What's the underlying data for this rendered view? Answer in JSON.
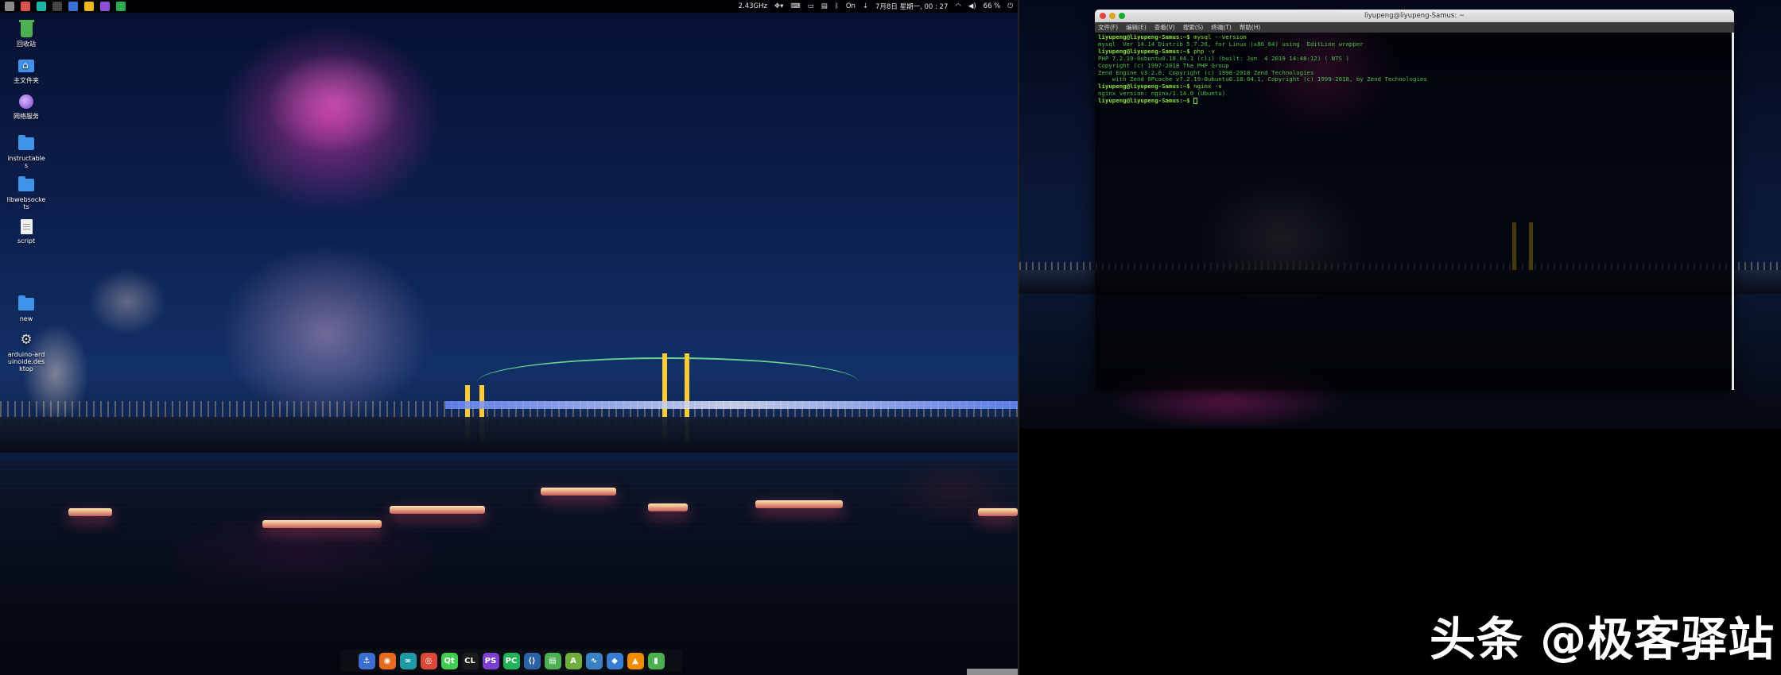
{
  "topbar": {
    "apps": [
      {
        "icon": "files-icon",
        "color": "#8a8a8a"
      },
      {
        "icon": "app-red-icon",
        "color": "#d9534f"
      },
      {
        "icon": "shield-icon",
        "color": "#1bb5a5"
      },
      {
        "icon": "terminal-icon",
        "color": "#444444"
      },
      {
        "icon": "editor-icon",
        "color": "#3a6fd6"
      },
      {
        "icon": "chrome-icon",
        "color": "#e8b923"
      },
      {
        "icon": "jetbrains-icon",
        "color": "#8d4fd6"
      },
      {
        "icon": "monitor-icon",
        "color": "#2fa84f"
      }
    ],
    "cpu": "2.43GHz",
    "input_method": "On",
    "datetime": "7月8日 星期一, 00 : 27",
    "battery": "66 %"
  },
  "desktop": {
    "icons": [
      {
        "label": "回收站",
        "icon": "trash-icon"
      },
      {
        "label": "主文件夹",
        "icon": "home-folder-icon"
      },
      {
        "label": "网络服务",
        "icon": "network-icon"
      },
      {
        "label": "instructables",
        "icon": "folder-icon"
      },
      {
        "label": "libwebsockets",
        "icon": "folder-icon"
      },
      {
        "label": "script",
        "icon": "document-icon"
      },
      {
        "label": "new",
        "icon": "folder-icon"
      },
      {
        "label": "arduino-arduinoide.desktop",
        "icon": "gear-icon"
      }
    ]
  },
  "dock": {
    "items": [
      {
        "icon": "anchor-icon",
        "glyph": "⚓",
        "color": "#3b6fcf"
      },
      {
        "icon": "firefox-icon",
        "glyph": "◉",
        "color": "#e66a1f"
      },
      {
        "icon": "arduino-icon",
        "glyph": "∞",
        "color": "#1f9aa5"
      },
      {
        "icon": "chrome-icon",
        "glyph": "◎",
        "color": "#d94a38"
      },
      {
        "icon": "qt-icon",
        "glyph": "Qt",
        "color": "#41cd52"
      },
      {
        "icon": "clion-icon",
        "glyph": "CL",
        "color": "#1b1b1b"
      },
      {
        "icon": "phpstorm-icon",
        "glyph": "PS",
        "color": "#7c3fd0"
      },
      {
        "icon": "pycharm-icon",
        "glyph": "PC",
        "color": "#20b35a"
      },
      {
        "icon": "vscode-icon",
        "glyph": "⟨⟩",
        "color": "#2b63a8"
      },
      {
        "icon": "files-icon",
        "glyph": "▤",
        "color": "#4caf50"
      },
      {
        "icon": "android-studio-icon",
        "glyph": "A",
        "color": "#6fae3a"
      },
      {
        "icon": "monitor-icon",
        "glyph": "∿",
        "color": "#3b82c4"
      },
      {
        "icon": "bag-icon",
        "glyph": "◆",
        "color": "#3a7bd5"
      },
      {
        "icon": "vlc-icon",
        "glyph": "▲",
        "color": "#f08c00"
      },
      {
        "icon": "trash-icon",
        "glyph": "▮",
        "color": "#4caf50"
      }
    ]
  },
  "terminal": {
    "title": "liyupeng@liyupeng-Samus: ~",
    "menu": [
      "文件(F)",
      "编辑(E)",
      "查看(V)",
      "搜索(S)",
      "终端(T)",
      "帮助(H)"
    ],
    "lines": [
      {
        "type": "prompt",
        "prompt": "liyupeng@liyupeng-Samus:~$",
        "text": " mysql --version"
      },
      {
        "type": "output",
        "text": "mysql  Ver 14.14 Distrib 5.7.26, for Linux (x86_64) using  EditLine wrapper"
      },
      {
        "type": "prompt",
        "prompt": "liyupeng@liyupeng-Samus:~$",
        "text": " php -v"
      },
      {
        "type": "output",
        "text": "PHP 7.2.19-0ubuntu0.18.04.1 (cli) (built: Jun  4 2019 14:48:12) ( NTS )"
      },
      {
        "type": "output",
        "text": "Copyright (c) 1997-2018 The PHP Group"
      },
      {
        "type": "output",
        "text": "Zend Engine v3.2.0, Copyright (c) 1998-2018 Zend Technologies"
      },
      {
        "type": "output",
        "text": "    with Zend OPcache v7.2.19-0ubuntu0.18.04.1, Copyright (c) 1999-2018, by Zend Technologies"
      },
      {
        "type": "prompt",
        "prompt": "liyupeng@liyupeng-Samus:~$",
        "text": " nginx -v"
      },
      {
        "type": "output",
        "text": "nginx version: nginx/1.14.0 (Ubuntu)"
      },
      {
        "type": "prompt",
        "prompt": "liyupeng@liyupeng-Samus:~$",
        "text": " "
      }
    ]
  },
  "watermark": "头条 @极客驿站"
}
